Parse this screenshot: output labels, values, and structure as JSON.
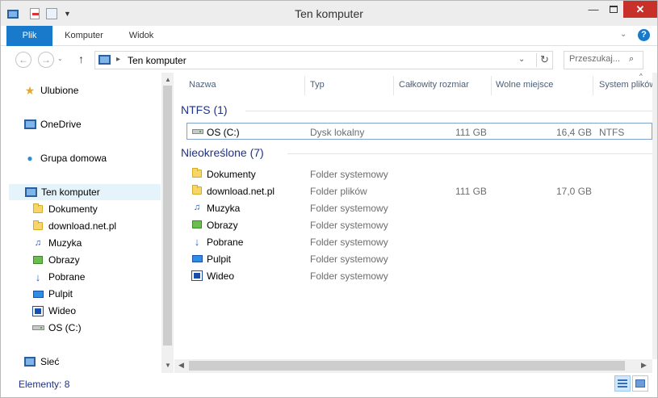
{
  "window": {
    "title": "Ten komputer"
  },
  "ribbon": {
    "tabs": [
      {
        "label": "Plik"
      },
      {
        "label": "Komputer"
      },
      {
        "label": "Widok"
      }
    ]
  },
  "address": {
    "path": "Ten komputer",
    "search_placeholder": "Przeszukaj..."
  },
  "sidebar": {
    "items": [
      {
        "label": "Ulubione",
        "icon": "star-icon"
      },
      {
        "label": "OneDrive",
        "icon": "cloud-icon"
      },
      {
        "label": "Grupa domowa",
        "icon": "homegroup-icon"
      },
      {
        "label": "Ten komputer",
        "icon": "computer-icon"
      },
      {
        "label": "Dokumenty",
        "icon": "documents-folder-icon"
      },
      {
        "label": "download.net.pl",
        "icon": "folder-icon"
      },
      {
        "label": "Muzyka",
        "icon": "music-folder-icon"
      },
      {
        "label": "Obrazy",
        "icon": "pictures-folder-icon"
      },
      {
        "label": "Pobrane",
        "icon": "downloads-folder-icon"
      },
      {
        "label": "Pulpit",
        "icon": "desktop-folder-icon"
      },
      {
        "label": "Wideo",
        "icon": "videos-folder-icon"
      },
      {
        "label": "OS (C:)",
        "icon": "drive-icon"
      },
      {
        "label": "Sieć",
        "icon": "network-icon"
      }
    ]
  },
  "columns": [
    {
      "label": "Nazwa"
    },
    {
      "label": "Typ"
    },
    {
      "label": "Całkowity rozmiar"
    },
    {
      "label": "Wolne miejsce"
    },
    {
      "label": "System plików"
    }
  ],
  "groups": [
    {
      "label": "NTFS (1)",
      "rows": [
        {
          "name": "OS (C:)",
          "type": "Dysk lokalny",
          "total": "111 GB",
          "free": "16,4 GB",
          "fs": "NTFS"
        }
      ]
    },
    {
      "label": "Nieokreślone (7)",
      "rows": [
        {
          "name": "Dokumenty",
          "type": "Folder systemowy",
          "total": "",
          "free": "",
          "fs": ""
        },
        {
          "name": "download.net.pl",
          "type": "Folder plików",
          "total": "111 GB",
          "free": "17,0 GB",
          "fs": ""
        },
        {
          "name": "Muzyka",
          "type": "Folder systemowy",
          "total": "",
          "free": "",
          "fs": ""
        },
        {
          "name": "Obrazy",
          "type": "Folder systemowy",
          "total": "",
          "free": "",
          "fs": ""
        },
        {
          "name": "Pobrane",
          "type": "Folder systemowy",
          "total": "",
          "free": "",
          "fs": ""
        },
        {
          "name": "Pulpit",
          "type": "Folder systemowy",
          "total": "",
          "free": "",
          "fs": ""
        },
        {
          "name": "Wideo",
          "type": "Folder systemowy",
          "total": "",
          "free": "",
          "fs": ""
        }
      ]
    }
  ],
  "status": {
    "text": "Elementy: 8"
  },
  "colors": {
    "accent": "#1979ca",
    "group_text": "#1e3287",
    "close": "#c7312a"
  }
}
